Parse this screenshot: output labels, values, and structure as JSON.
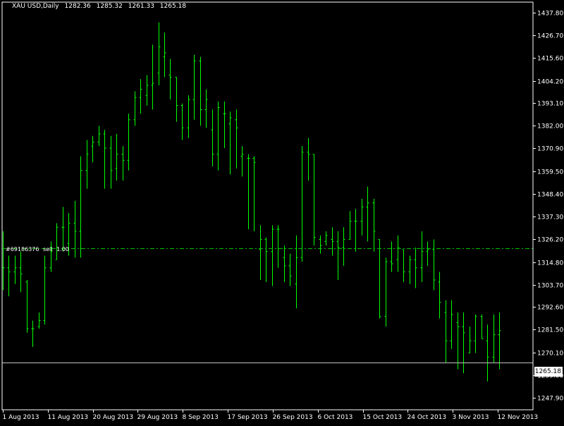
{
  "header": {
    "symbol": "XAU USD,Daily",
    "open": "1282.36",
    "high": "1285.32",
    "low": "1261.33",
    "close": "1265.18"
  },
  "order_line": {
    "ticket": "#69186376",
    "type": "sell",
    "lots": "1.00",
    "price": 1321.7
  },
  "current_price_label": "1265.18",
  "colors": {
    "background": "#000000",
    "bars": "#00ff00",
    "axis": "#ffffff",
    "order_line": "#00c000",
    "price_line": "#c0c0c0"
  },
  "chart_data": {
    "type": "ohlc",
    "title": "XAU USD,Daily",
    "ylim": [
      1242,
      1443
    ],
    "y_ticks": [
      "1437.80",
      "1426.70",
      "1415.60",
      "1404.20",
      "1393.10",
      "1382.00",
      "1370.90",
      "1359.50",
      "1348.40",
      "1337.30",
      "1326.20",
      "1314.80",
      "1303.70",
      "1292.60",
      "1281.50",
      "1270.10",
      "1259.00",
      "1247.90"
    ],
    "x_ticks": [
      "1 Aug 2013",
      "11 Aug 2013",
      "20 Aug 2013",
      "29 Aug 2013",
      "8 Sep 2013",
      "17 Sep 2013",
      "26 Sep 2013",
      "6 Oct 2013",
      "15 Oct 2013",
      "24 Oct 2013",
      "3 Nov 2013",
      "12 Nov 2013"
    ],
    "bars": [
      {
        "date": "2013-07-31",
        "o": 1312,
        "h": 1330,
        "l": 1301,
        "c": 1312
      },
      {
        "date": "2013-08-01",
        "o": 1312,
        "h": 1318,
        "l": 1298,
        "c": 1310
      },
      {
        "date": "2013-08-02",
        "o": 1310,
        "h": 1318,
        "l": 1304,
        "c": 1312
      },
      {
        "date": "2013-08-05",
        "o": 1312,
        "h": 1320,
        "l": 1300,
        "c": 1309
      },
      {
        "date": "2013-08-06",
        "o": 1305,
        "h": 1306,
        "l": 1280,
        "c": 1282
      },
      {
        "date": "2013-08-07",
        "o": 1282,
        "h": 1286,
        "l": 1273,
        "c": 1282
      },
      {
        "date": "2013-08-08",
        "o": 1283,
        "h": 1290,
        "l": 1282,
        "c": 1286
      },
      {
        "date": "2013-08-09",
        "o": 1286,
        "h": 1318,
        "l": 1284,
        "c": 1312
      },
      {
        "date": "2013-08-12",
        "o": 1312,
        "h": 1325,
        "l": 1310,
        "c": 1320
      },
      {
        "date": "2013-08-13",
        "o": 1316,
        "h": 1334,
        "l": 1316,
        "c": 1332
      },
      {
        "date": "2013-08-14",
        "o": 1332,
        "h": 1342,
        "l": 1320,
        "c": 1332
      },
      {
        "date": "2013-08-15",
        "o": 1324,
        "h": 1339,
        "l": 1318,
        "c": 1334
      },
      {
        "date": "2013-08-16",
        "o": 1334,
        "h": 1345,
        "l": 1317,
        "c": 1330
      },
      {
        "date": "2013-08-19",
        "o": 1330,
        "h": 1367,
        "l": 1317,
        "c": 1360
      },
      {
        "date": "2013-08-20",
        "o": 1360,
        "h": 1375,
        "l": 1351,
        "c": 1368
      },
      {
        "date": "2013-08-21",
        "o": 1372,
        "h": 1377,
        "l": 1364,
        "c": 1374
      },
      {
        "date": "2013-08-22",
        "o": 1374,
        "h": 1382,
        "l": 1372,
        "c": 1378
      },
      {
        "date": "2013-08-23",
        "o": 1378,
        "h": 1380,
        "l": 1351,
        "c": 1371
      },
      {
        "date": "2013-08-26",
        "o": 1371,
        "h": 1377,
        "l": 1351,
        "c": 1360
      },
      {
        "date": "2013-08-27",
        "o": 1361,
        "h": 1378,
        "l": 1355,
        "c": 1368
      },
      {
        "date": "2013-08-28",
        "o": 1368,
        "h": 1372,
        "l": 1355,
        "c": 1365
      },
      {
        "date": "2013-08-29",
        "o": 1365,
        "h": 1388,
        "l": 1360,
        "c": 1385
      },
      {
        "date": "2013-08-30",
        "o": 1385,
        "h": 1399,
        "l": 1382,
        "c": 1396
      },
      {
        "date": "2013-09-02",
        "o": 1396,
        "h": 1405,
        "l": 1388,
        "c": 1400
      },
      {
        "date": "2013-09-03",
        "o": 1397,
        "h": 1407,
        "l": 1392,
        "c": 1402
      },
      {
        "date": "2013-09-04",
        "o": 1402,
        "h": 1422,
        "l": 1390,
        "c": 1403
      },
      {
        "date": "2013-09-05",
        "o": 1408,
        "h": 1433,
        "l": 1402,
        "c": 1421
      },
      {
        "date": "2013-09-06",
        "o": 1416,
        "h": 1428,
        "l": 1406,
        "c": 1418
      },
      {
        "date": "2013-09-09",
        "o": 1407,
        "h": 1415,
        "l": 1395,
        "c": 1406
      },
      {
        "date": "2013-09-10",
        "o": 1406,
        "h": 1406,
        "l": 1384,
        "c": 1392
      },
      {
        "date": "2013-09-11",
        "o": 1392,
        "h": 1393,
        "l": 1375,
        "c": 1381
      },
      {
        "date": "2013-09-12",
        "o": 1381,
        "h": 1397,
        "l": 1376,
        "c": 1395
      },
      {
        "date": "2013-09-13",
        "o": 1395,
        "h": 1417,
        "l": 1385,
        "c": 1414
      },
      {
        "date": "2013-09-16",
        "o": 1414,
        "h": 1416,
        "l": 1382,
        "c": 1390
      },
      {
        "date": "2013-09-17",
        "o": 1390,
        "h": 1400,
        "l": 1381,
        "c": 1395
      },
      {
        "date": "2013-09-18",
        "o": 1380,
        "h": 1390,
        "l": 1362,
        "c": 1368
      },
      {
        "date": "2013-09-19",
        "o": 1368,
        "h": 1394,
        "l": 1360,
        "c": 1391
      },
      {
        "date": "2013-09-20",
        "o": 1388,
        "h": 1394,
        "l": 1371,
        "c": 1388
      },
      {
        "date": "2013-09-23",
        "o": 1383,
        "h": 1389,
        "l": 1358,
        "c": 1386
      },
      {
        "date": "2013-09-24",
        "o": 1385,
        "h": 1390,
        "l": 1361,
        "c": 1381
      },
      {
        "date": "2013-09-25",
        "o": 1367,
        "h": 1372,
        "l": 1357,
        "c": 1368
      },
      {
        "date": "2013-09-26",
        "o": 1366,
        "h": 1368,
        "l": 1331,
        "c": 1366
      },
      {
        "date": "2013-09-27",
        "o": 1366,
        "h": 1367,
        "l": 1330,
        "c": 1364
      },
      {
        "date": "2013-09-30",
        "o": 1321,
        "h": 1333,
        "l": 1306,
        "c": 1326
      },
      {
        "date": "2013-10-01",
        "o": 1326,
        "h": 1327,
        "l": 1305,
        "c": 1320
      },
      {
        "date": "2013-10-02",
        "o": 1320,
        "h": 1333,
        "l": 1303,
        "c": 1331
      },
      {
        "date": "2013-10-03",
        "o": 1331,
        "h": 1333,
        "l": 1312,
        "c": 1331
      },
      {
        "date": "2013-10-04",
        "o": 1317,
        "h": 1323,
        "l": 1305,
        "c": 1313
      },
      {
        "date": "2013-10-07",
        "o": 1313,
        "h": 1319,
        "l": 1303,
        "c": 1308
      },
      {
        "date": "2013-10-08",
        "o": 1304,
        "h": 1328,
        "l": 1292,
        "c": 1317
      },
      {
        "date": "2013-10-09",
        "o": 1317,
        "h": 1372,
        "l": 1315,
        "c": 1369
      },
      {
        "date": "2013-10-10",
        "o": 1369,
        "h": 1376,
        "l": 1355,
        "c": 1368
      },
      {
        "date": "2013-10-11",
        "o": 1368,
        "h": 1368,
        "l": 1323,
        "c": 1327
      },
      {
        "date": "2013-10-14",
        "o": 1326,
        "h": 1328,
        "l": 1319,
        "c": 1323
      },
      {
        "date": "2013-10-15",
        "o": 1325,
        "h": 1330,
        "l": 1323,
        "c": 1328
      },
      {
        "date": "2013-10-16",
        "o": 1326,
        "h": 1332,
        "l": 1318,
        "c": 1325
      },
      {
        "date": "2013-10-17",
        "o": 1325,
        "h": 1330,
        "l": 1306,
        "c": 1322
      },
      {
        "date": "2013-10-18",
        "o": 1322,
        "h": 1332,
        "l": 1313,
        "c": 1326
      },
      {
        "date": "2013-10-21",
        "o": 1326,
        "h": 1340,
        "l": 1326,
        "c": 1335
      },
      {
        "date": "2013-10-22",
        "o": 1335,
        "h": 1341,
        "l": 1320,
        "c": 1335
      },
      {
        "date": "2013-10-23",
        "o": 1335,
        "h": 1346,
        "l": 1328,
        "c": 1342
      },
      {
        "date": "2013-10-24",
        "o": 1342,
        "h": 1352,
        "l": 1325,
        "c": 1344
      },
      {
        "date": "2013-10-25",
        "o": 1344,
        "h": 1346,
        "l": 1320,
        "c": 1330
      },
      {
        "date": "2013-10-28",
        "o": 1326,
        "h": 1326,
        "l": 1287,
        "c": 1288
      },
      {
        "date": "2013-10-29",
        "o": 1288,
        "h": 1317,
        "l": 1283,
        "c": 1315
      },
      {
        "date": "2013-10-30",
        "o": 1315,
        "h": 1325,
        "l": 1310,
        "c": 1314
      },
      {
        "date": "2013-10-31",
        "o": 1316,
        "h": 1328,
        "l": 1310,
        "c": 1322
      },
      {
        "date": "2013-11-01",
        "o": 1321,
        "h": 1321,
        "l": 1305,
        "c": 1310
      },
      {
        "date": "2013-11-04",
        "o": 1310,
        "h": 1318,
        "l": 1304,
        "c": 1316
      },
      {
        "date": "2013-11-05",
        "o": 1316,
        "h": 1322,
        "l": 1302,
        "c": 1312
      },
      {
        "date": "2013-11-06",
        "o": 1312,
        "h": 1330,
        "l": 1305,
        "c": 1320
      },
      {
        "date": "2013-11-07",
        "o": 1320,
        "h": 1325,
        "l": 1313,
        "c": 1321
      },
      {
        "date": "2013-11-08",
        "o": 1321,
        "h": 1326,
        "l": 1301,
        "c": 1306
      },
      {
        "date": "2013-11-09",
        "o": 1305,
        "h": 1310,
        "l": 1287,
        "c": 1295
      },
      {
        "date": "2013-11-11",
        "o": 1290,
        "h": 1296,
        "l": 1265,
        "c": 1276
      },
      {
        "date": "2013-11-12",
        "o": 1276,
        "h": 1296,
        "l": 1272,
        "c": 1289
      },
      {
        "date": "2013-11-13",
        "o": 1285,
        "h": 1290,
        "l": 1262,
        "c": 1283
      },
      {
        "date": "2013-11-14",
        "o": 1283,
        "h": 1290,
        "l": 1260,
        "c": 1280
      },
      {
        "date": "2013-11-15",
        "o": 1270,
        "h": 1283,
        "l": 1270,
        "c": 1276
      },
      {
        "date": "2013-11-18",
        "o": 1276,
        "h": 1289,
        "l": 1270,
        "c": 1288
      },
      {
        "date": "2013-11-19",
        "o": 1288,
        "h": 1289,
        "l": 1277,
        "c": 1277
      },
      {
        "date": "2013-11-20",
        "o": 1276,
        "h": 1284,
        "l": 1256,
        "c": 1268
      },
      {
        "date": "2013-11-21",
        "o": 1268,
        "h": 1289,
        "l": 1265,
        "c": 1279
      },
      {
        "date": "2013-11-22",
        "o": 1279,
        "h": 1290,
        "l": 1262,
        "c": 1281
      }
    ]
  }
}
